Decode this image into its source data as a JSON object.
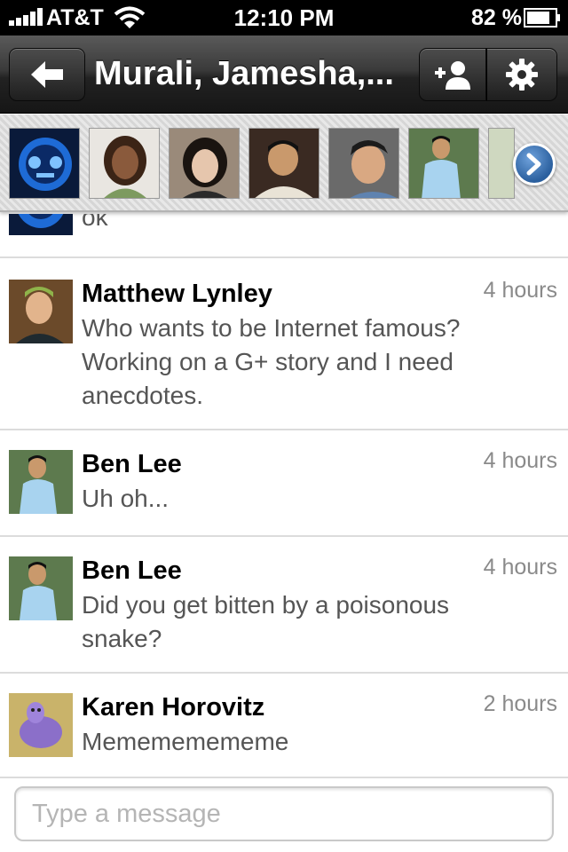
{
  "status_bar": {
    "carrier": "AT&T",
    "time": "12:10 PM",
    "battery_percent": "82 %",
    "battery_level": 0.82,
    "icons": [
      "signal-bars-icon",
      "wifi-icon",
      "battery-icon"
    ]
  },
  "nav": {
    "title": "Murali, Jamesha,...",
    "icons": [
      "back-arrow-icon",
      "add-person-icon",
      "gear-icon"
    ]
  },
  "participants": {
    "count_visible": 7,
    "more_icon": "chevron-right-icon"
  },
  "partial_message": {
    "text": "ok"
  },
  "messages": [
    {
      "name": "Matthew Lynley",
      "time": "4 hours",
      "lines": [
        "Who wants to be Internet famous?",
        "Working on a G+ story and I need",
        "anecdotes."
      ]
    },
    {
      "name": "Ben Lee",
      "time": "4 hours",
      "lines": [
        "Uh oh..."
      ]
    },
    {
      "name": "Ben Lee",
      "time": "4 hours",
      "lines": [
        "Did you get bitten by a poisonous",
        "snake?"
      ]
    },
    {
      "name": "Karen Horovitz",
      "time": "2 hours",
      "lines": [
        "Memememememe"
      ]
    }
  ],
  "composer": {
    "placeholder": "Type a message",
    "value": ""
  },
  "colors": {
    "nav_dark": "#222222",
    "accent_blue": "#2a5f9e",
    "timestamp_gray": "#8a8a8a",
    "body_text_gray": "#555555"
  }
}
